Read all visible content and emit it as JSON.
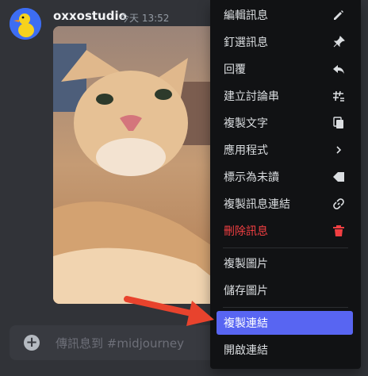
{
  "message": {
    "username": "oxxostudio",
    "timestamp": "今天 13:52"
  },
  "composer": {
    "placeholder": "傳訊息到 #midjourney"
  },
  "context_menu": {
    "items": [
      {
        "label": "編輯訊息",
        "icon": "pencil-icon"
      },
      {
        "label": "釘選訊息",
        "icon": "pin-icon"
      },
      {
        "label": "回覆",
        "icon": "reply-icon"
      },
      {
        "label": "建立討論串",
        "icon": "thread-icon"
      },
      {
        "label": "複製文字",
        "icon": "copy-icon"
      },
      {
        "label": "應用程式",
        "icon": "chevron-right-icon"
      },
      {
        "label": "標示為未讀",
        "icon": "unread-icon"
      },
      {
        "label": "複製訊息連結",
        "icon": "link-icon"
      },
      {
        "label": "刪除訊息",
        "icon": "trash-icon",
        "color": "#f23f42"
      },
      {
        "label": "複製圖片"
      },
      {
        "label": "儲存圖片"
      },
      {
        "label": "複製連結",
        "highlighted": true
      },
      {
        "label": "開啟連結"
      }
    ]
  },
  "colors": {
    "background": "#313338",
    "menu_background": "#111214",
    "highlight": "#5865f2",
    "danger": "#f23f42",
    "annotation_arrow": "#e8432d"
  }
}
